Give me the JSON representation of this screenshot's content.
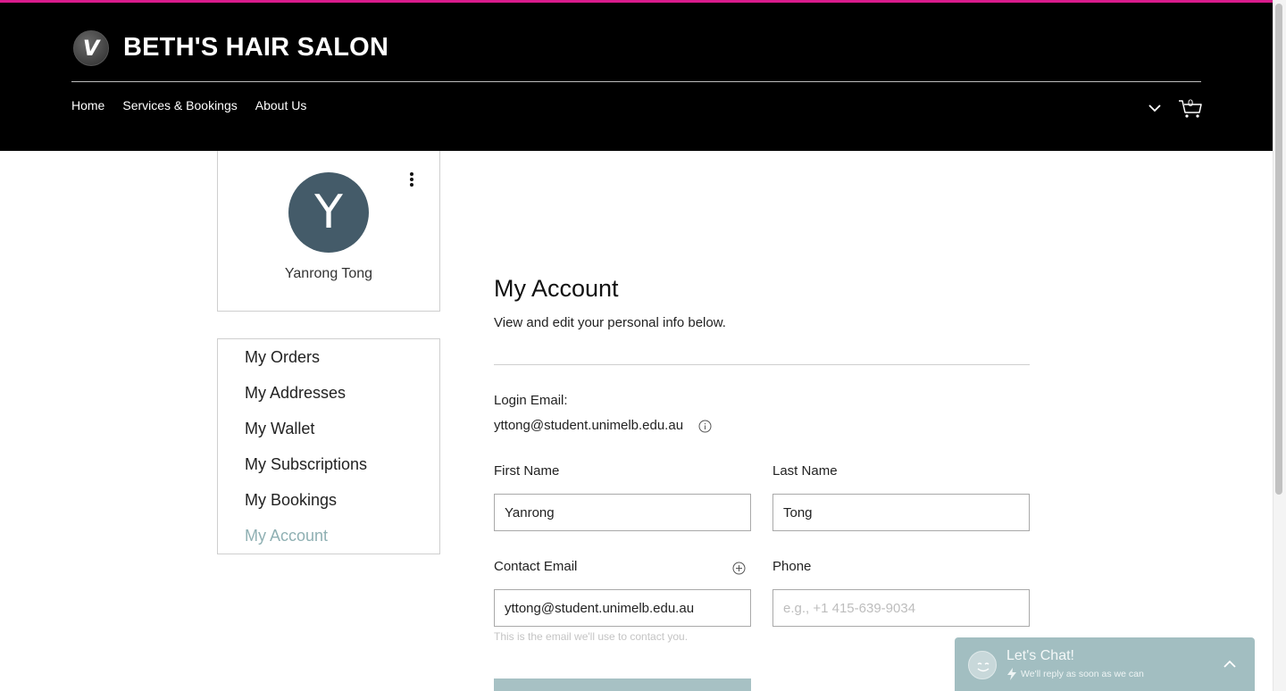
{
  "header": {
    "logo_letter": "V",
    "site_title": "BETH'S HAIR SALON",
    "accent_color": "#d81b8c",
    "nav": [
      {
        "label": "Home"
      },
      {
        "label": "Services & Bookings"
      },
      {
        "label": "About Us"
      }
    ],
    "cart_count": "0"
  },
  "profile": {
    "avatar_letter": "Y",
    "avatar_color": "#445b69",
    "name": "Yanrong Tong"
  },
  "side_menu": {
    "items": [
      {
        "label": "My Orders"
      },
      {
        "label": "My Addresses"
      },
      {
        "label": "My Wallet"
      },
      {
        "label": "My Subscriptions"
      },
      {
        "label": "My Bookings"
      },
      {
        "label": "My Account",
        "active": true
      }
    ],
    "active_color": "#8fb0b3"
  },
  "account": {
    "title": "My Account",
    "subtitle": "View and edit your personal info below.",
    "login_email_label": "Login Email:",
    "login_email": "yttong@student.unimelb.edu.au",
    "first_name_label": "First Name",
    "first_name_value": "Yanrong",
    "last_name_label": "Last Name",
    "last_name_value": "Tong",
    "contact_email_label": "Contact Email",
    "contact_email_value": "yttong@student.unimelb.edu.au",
    "contact_email_helper": "This is the email we'll use to contact you.",
    "phone_label": "Phone",
    "phone_placeholder": "e.g., +1 415-639-9034"
  },
  "chat": {
    "title": "Let's Chat!",
    "subtitle": "We'll reply as soon as we can"
  }
}
